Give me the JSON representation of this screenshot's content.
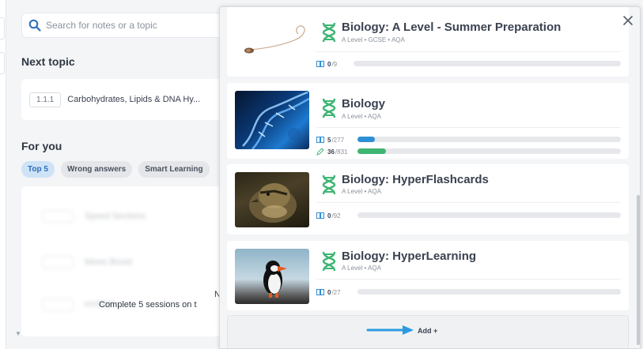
{
  "background": {
    "search": {
      "placeholder": "Search for notes or a topic"
    },
    "next_topic": {
      "title": "Next topic",
      "number": "1.1.1",
      "name": "Carbohydrates, Lipids & DNA Hy..."
    },
    "for_you": {
      "title": "For you",
      "chips": [
        "Top 5",
        "Wrong answers",
        "Smart Learning"
      ],
      "blurred_items": [
        "Speed Sections",
        "Mews Boost",
        "HYPER"
      ],
      "message_n": "N",
      "message": "Complete 5 sessions on t"
    }
  },
  "modal": {
    "courses": [
      {
        "title": "Biology: A Level - Summer Preparation",
        "subtitle": "A Level • GCSE • AQA",
        "stats": [
          {
            "icon": "book-icon",
            "done": "0",
            "total": "/9",
            "progress": 0
          }
        ]
      },
      {
        "title": "Biology",
        "subtitle": "A Level • AQA",
        "stats": [
          {
            "icon": "book-icon",
            "done": "5",
            "total": "/277",
            "progress": 0.018
          },
          {
            "icon": "pencil-icon",
            "done": "36",
            "total": "/831",
            "progress": 0.043
          }
        ]
      },
      {
        "title": "Biology: HyperFlashcards",
        "subtitle": "A Level • AQA",
        "stats": [
          {
            "icon": "book-icon",
            "done": "0",
            "total": "/92",
            "progress": 0
          }
        ]
      },
      {
        "title": "Biology: HyperLearning",
        "subtitle": "A Level • AQA",
        "stats": [
          {
            "icon": "book-icon",
            "done": "0",
            "total": "/27",
            "progress": 0
          }
        ]
      }
    ],
    "add_label": "Add +"
  },
  "colors": {
    "accent_green": "#3fb573",
    "accent_blue": "#2d8fd5",
    "search_blue": "#2a6fb8"
  }
}
